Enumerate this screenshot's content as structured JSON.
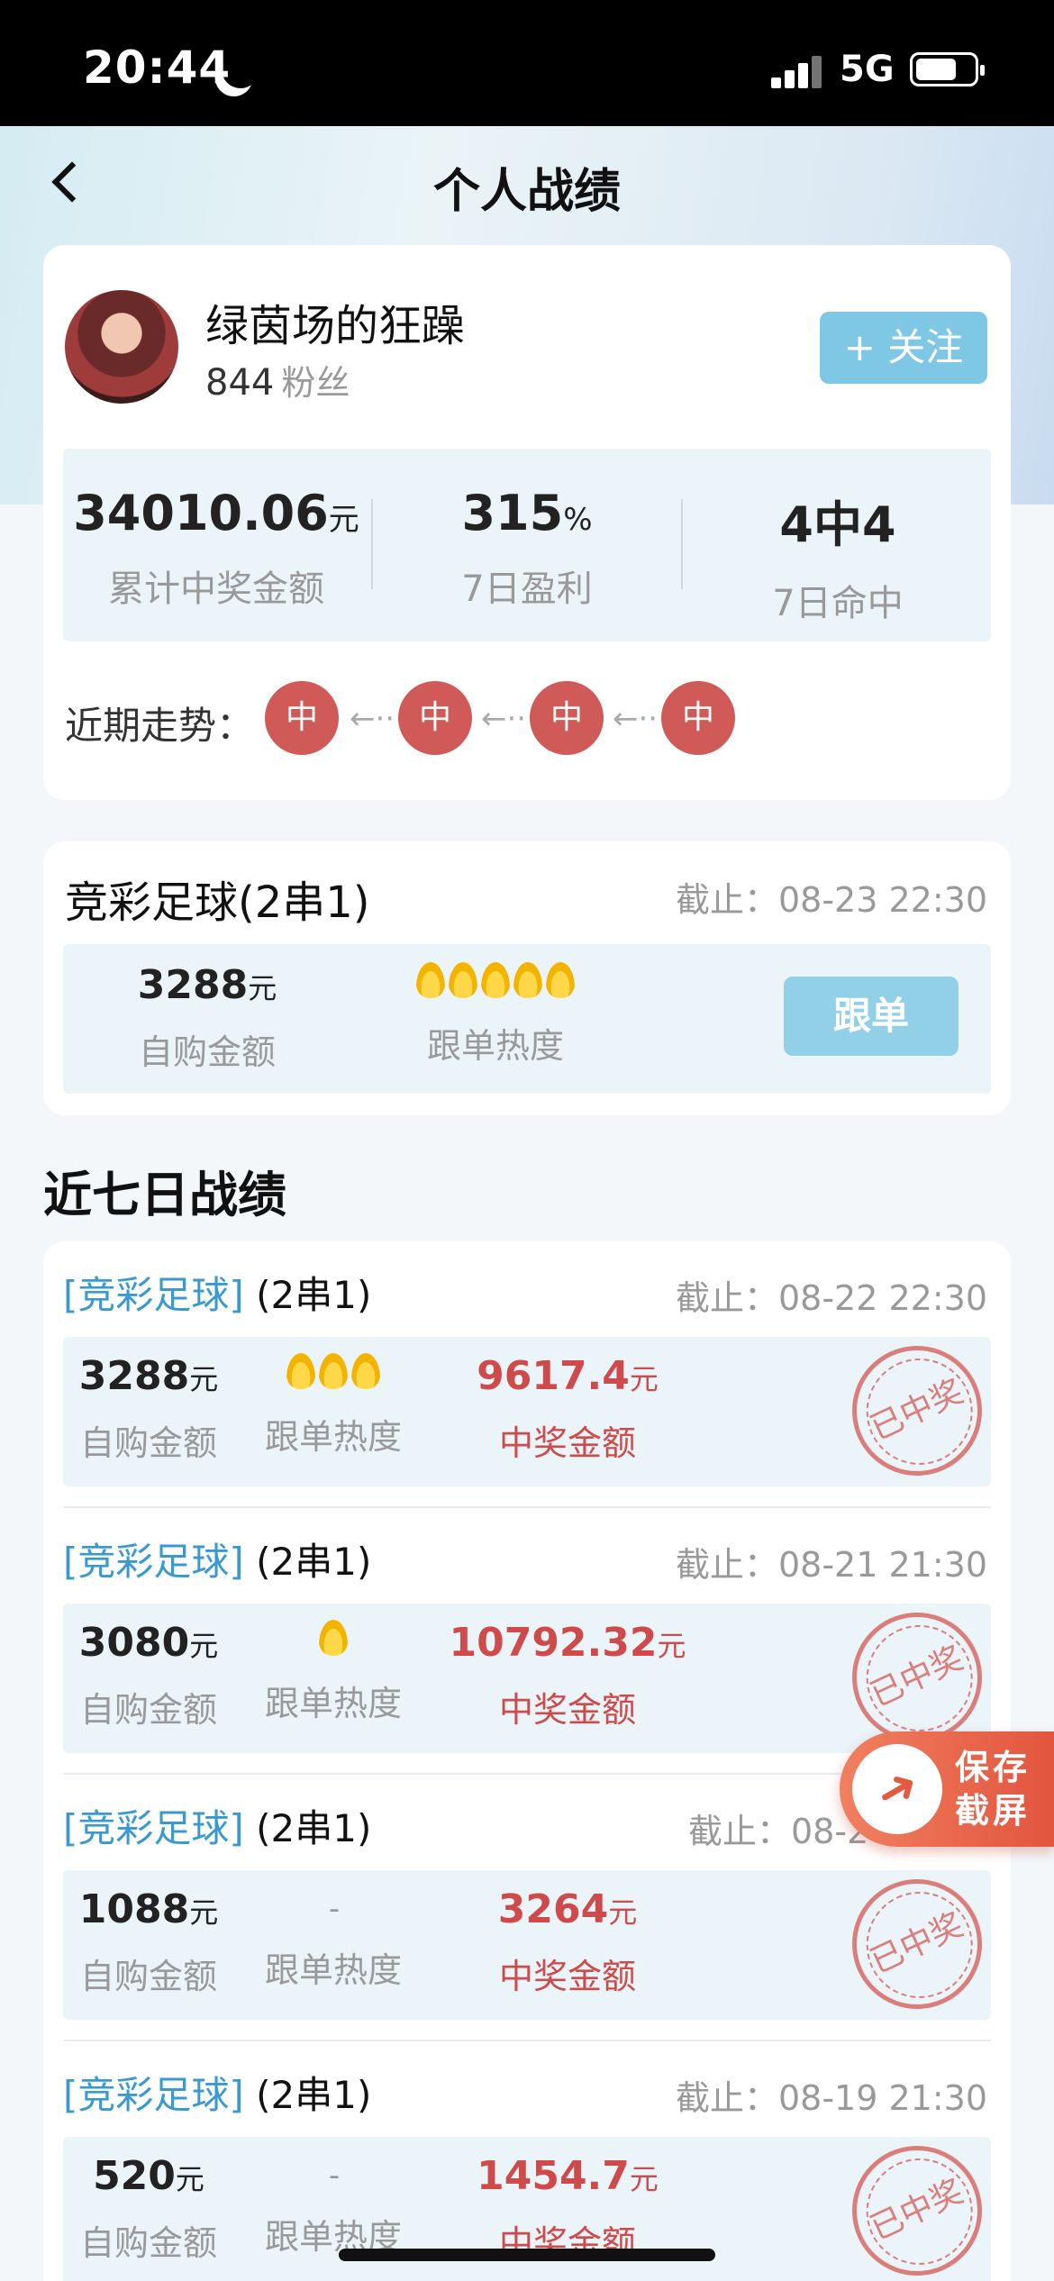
{
  "status_bar": {
    "time": "20:44",
    "network": "5G"
  },
  "nav": {
    "title": "个人战绩"
  },
  "profile": {
    "name": "绿茵场的狂躁",
    "fans_count": "844",
    "fans_label": "粉丝",
    "follow_label": "+ 关注",
    "stats": [
      {
        "value": "34010.06",
        "unit": "元",
        "label": "累计中奖金额"
      },
      {
        "value": "315",
        "unit": "%",
        "label": "7日盈利"
      },
      {
        "value": "4中4",
        "unit": "",
        "label": "7日命中"
      }
    ],
    "trend_label": "近期走势：",
    "trend": [
      "中",
      "中",
      "中",
      "中"
    ]
  },
  "current": {
    "title": "竞彩足球(2串1)",
    "deadline": "截止：08-23 22:30",
    "amount": "3288",
    "unit": "元",
    "amount_label": "自购金额",
    "heat_label": "跟单热度",
    "heat_level": 5,
    "follow_btn": "跟单"
  },
  "section_title": "近七日战绩",
  "records": [
    {
      "tag": "[竞彩足球]",
      "type": "(2串1)",
      "deadline": "截止：08-22 22:30",
      "amount": "3288",
      "unit": "元",
      "amount_label": "自购金额",
      "heat_label": "跟单热度",
      "heat_level": 3,
      "win": "9617.4",
      "win_label": "中奖金额",
      "stamp": "已中奖"
    },
    {
      "tag": "[竞彩足球]",
      "type": "(2串1)",
      "deadline": "截止：08-21 21:30",
      "amount": "3080",
      "unit": "元",
      "amount_label": "自购金额",
      "heat_label": "跟单热度",
      "heat_level": 1,
      "win": "10792.32",
      "win_label": "中奖金额",
      "stamp": "已中奖"
    },
    {
      "tag": "[竞彩足球]",
      "type": "(2串1)",
      "deadline": "截止：08-2",
      "amount": "1088",
      "unit": "元",
      "amount_label": "自购金额",
      "heat_label": "跟单热度",
      "heat_level": 0,
      "heat_empty": "-",
      "win": "3264",
      "win_label": "中奖金额",
      "stamp": "已中奖"
    },
    {
      "tag": "[竞彩足球]",
      "type": "(2串1)",
      "deadline": "截止：08-19 21:30",
      "amount": "520",
      "unit": "元",
      "amount_label": "自购金额",
      "heat_label": "跟单热度",
      "heat_level": 0,
      "heat_empty": "-",
      "win": "1454.7",
      "win_label": "中奖金额",
      "stamp": "已中奖"
    }
  ],
  "save_button": {
    "line1": "保存",
    "line2": "截屏"
  },
  "colors": {
    "accent": "#7ec8e5",
    "win": "#cf4a4a",
    "trend_dot": "#cf5a57"
  }
}
